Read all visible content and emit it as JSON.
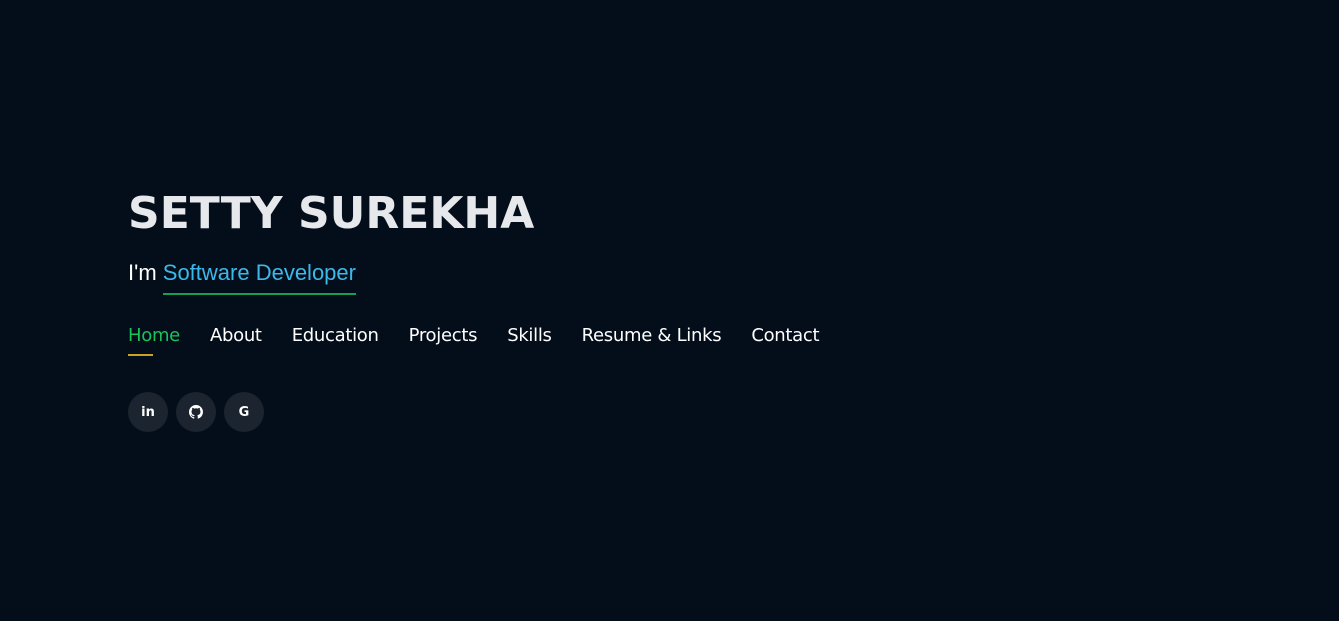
{
  "hero": {
    "name": "SETTY SUREKHA",
    "tagline_prefix": "I'm ",
    "tagline_typed": "Software Developer"
  },
  "nav": {
    "items": [
      {
        "label": "Home",
        "active": true
      },
      {
        "label": "About"
      },
      {
        "label": "Education"
      },
      {
        "label": "Projects"
      },
      {
        "label": "Skills"
      },
      {
        "label": "Resume & Links"
      },
      {
        "label": "Contact"
      }
    ]
  },
  "social": {
    "items": [
      {
        "icon": "linkedin-icon",
        "glyph": "in"
      },
      {
        "icon": "github-icon"
      },
      {
        "icon": "google-icon",
        "glyph": "G"
      }
    ]
  },
  "colors": {
    "background": "#040e1b",
    "active_nav": "#18c35a",
    "typed_text": "#3cb8e9",
    "typed_underline": "#169f53",
    "active_underline": "#c9a324"
  }
}
